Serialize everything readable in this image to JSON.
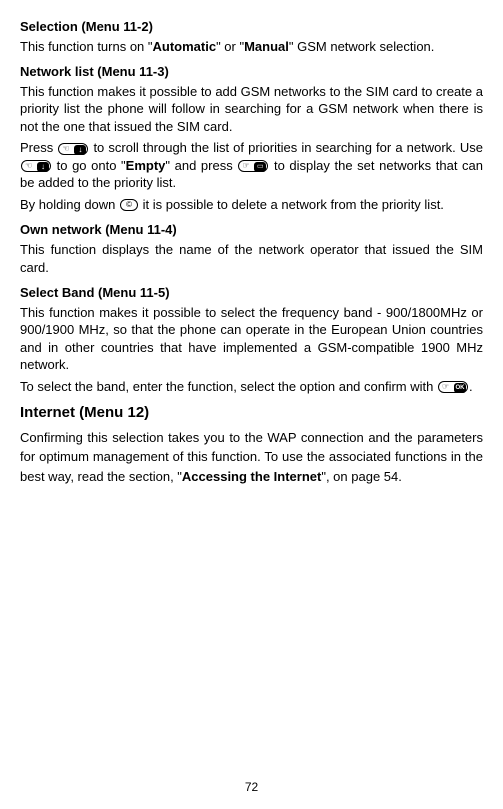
{
  "sec1": {
    "title": "Selection (Menu 11-2)",
    "p1a": "This function turns on \"",
    "p1b": "Automatic",
    "p1c": "\" or \"",
    "p1d": "Manual",
    "p1e": "\" GSM network selection."
  },
  "sec2": {
    "title": "Network list (Menu 11-3)",
    "p1": "This function makes it possible to add GSM networks to the SIM card to create a priority list the phone will follow in searching for a GSM network when there is not the one that issued the SIM card.",
    "p2a": "Press ",
    "p2b": " to scroll through the list of priorities in searching for a network. Use ",
    "p2c": " to go onto \"",
    "p2d": "Empty",
    "p2e": "\" and press ",
    "p2f": " to display the set networks that can be added to the priority list.",
    "p3a": "By holding down ",
    "p3b": " it is possible to delete a network from the priority list."
  },
  "sec3": {
    "title": "Own network (Menu 11-4)",
    "p1": "This function displays the name of the network operator that issued the SIM card."
  },
  "sec4": {
    "title": "Select Band (Menu 11-5)",
    "p1": "This function makes it possible to select the frequency band  - 900/1800MHz or 900/1900 MHz, so that the phone can operate in the European Union countries and in other countries that have implemented a GSM-compatible 1900 MHz network.",
    "p2a": "To select the band, enter the function, select the option and confirm with ",
    "p2b": "."
  },
  "sec5": {
    "title": "Internet (Menu 12)",
    "p1a": "Confirming this selection takes you to the WAP connection and the parameters for optimum management of this function. To use the associated functions in the best way, read the section, \"",
    "p1b": "Accessing the Internet",
    "p1c": "\", on page 54."
  },
  "pagenum": "72"
}
